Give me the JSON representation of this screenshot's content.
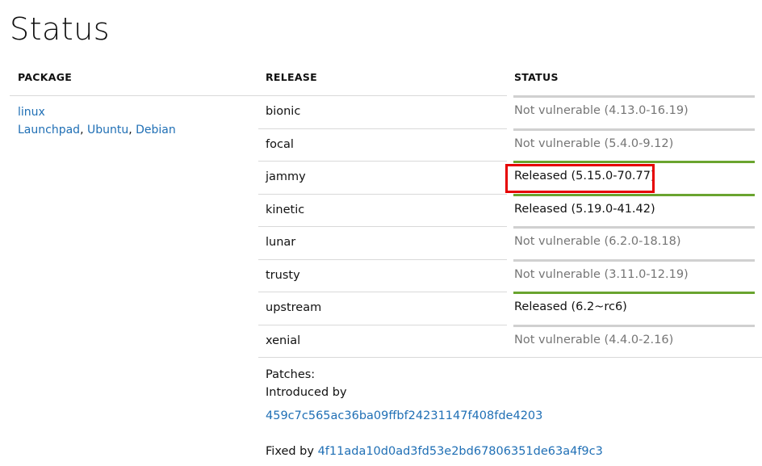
{
  "page": {
    "title": "Status"
  },
  "table": {
    "headers": {
      "package": "PACKAGE",
      "release": "RELEASE",
      "status": "STATUS"
    },
    "package": {
      "name": "linux",
      "links": [
        "Launchpad",
        "Ubuntu",
        "Debian"
      ],
      "separator": ","
    },
    "rows": [
      {
        "release": "bionic",
        "status": "Not vulnerable (4.13.0-16.19)",
        "kind": "not-vulnerable"
      },
      {
        "release": "focal",
        "status": "Not vulnerable (5.4.0-9.12)",
        "kind": "not-vulnerable"
      },
      {
        "release": "jammy",
        "status": "Released (5.15.0-70.77)",
        "kind": "released"
      },
      {
        "release": "kinetic",
        "status": "Released (5.19.0-41.42)",
        "kind": "released"
      },
      {
        "release": "lunar",
        "status": "Not vulnerable (6.2.0-18.18)",
        "kind": "not-vulnerable"
      },
      {
        "release": "trusty",
        "status": "Not vulnerable (3.11.0-12.19)",
        "kind": "not-vulnerable"
      },
      {
        "release": "upstream",
        "status": "Released (6.2~rc6)",
        "kind": "released"
      },
      {
        "release": "xenial",
        "status": "Not vulnerable (4.4.0-2.16)",
        "kind": "not-vulnerable"
      }
    ]
  },
  "patches": {
    "heading": "Patches:",
    "introduced_label": "Introduced by",
    "introduced_commit": "459c7c565ac36ba09ffbf24231147f408fde4203",
    "fixed_label": "Fixed by",
    "fixed_commit": "4f11ada10d0ad3fd53e2bd67806351de63a4f9c3"
  },
  "colors": {
    "link": "#1f6fb5",
    "released_bar": "#6aa42f",
    "neutral_bar": "#d0d0d0",
    "highlight": "#e60000",
    "muted_text": "#757575"
  }
}
